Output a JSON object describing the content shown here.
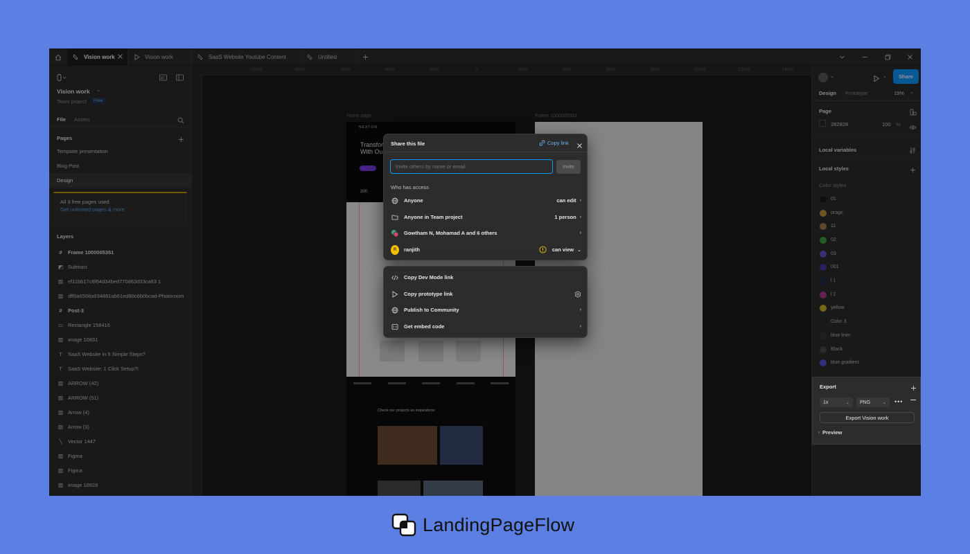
{
  "tabs": [
    {
      "label": "Vision work",
      "active": true,
      "icon": "figma-file-icon"
    },
    {
      "label": "Vision work",
      "active": false,
      "icon": "play-icon"
    },
    {
      "label": "SaaS Website Youtube Content",
      "active": false,
      "icon": "figma-file-icon"
    },
    {
      "label": "Untitled",
      "active": false,
      "icon": "figma-file-icon"
    }
  ],
  "left_panel": {
    "file_name": "Vision work",
    "team": "Team project",
    "plan_badge": "Free",
    "file_tab": "File",
    "assets_tab": "Assets",
    "pages_title": "Pages",
    "pages": [
      "Template presentation",
      "Blog Post",
      "Design"
    ],
    "notice": "All 3 free pages used.",
    "notice_link": "Get unlimited pages & more",
    "layers_title": "Layers",
    "layers": [
      {
        "name": "Frame 1000005351",
        "icon": "frame",
        "bold": true
      },
      {
        "name": "Subtract",
        "icon": "boolean",
        "bold": false
      },
      {
        "name": "ef11bb17c6f64d34bed770d83d33ca83 1",
        "icon": "image",
        "bold": false
      },
      {
        "name": "dff0a6558a934881ab61ed80c6b0bcad-Photoroom",
        "icon": "image",
        "bold": false
      },
      {
        "name": "Post-3",
        "icon": "frame",
        "bold": true
      },
      {
        "name": "Rectangle 158416",
        "icon": "rect",
        "bold": false
      },
      {
        "name": "image 10831",
        "icon": "image",
        "bold": false
      },
      {
        "name": "SaaS Website in 5 Simple Steps?",
        "icon": "text",
        "bold": false
      },
      {
        "name": "SaaS Website: 1 Click Setup?!",
        "icon": "text",
        "bold": false
      },
      {
        "name": "ARROW (42)",
        "icon": "image",
        "bold": false
      },
      {
        "name": "ARROW (51)",
        "icon": "image",
        "bold": false
      },
      {
        "name": "Arrow (4)",
        "icon": "image",
        "bold": false
      },
      {
        "name": "Arrow (3)",
        "icon": "image",
        "bold": false
      },
      {
        "name": "Vector 1447",
        "icon": "vector",
        "bold": false
      },
      {
        "name": "Figma",
        "icon": "image",
        "bold": false
      },
      {
        "name": "Figma",
        "icon": "image",
        "bold": false
      },
      {
        "name": "image 10828",
        "icon": "image",
        "bold": false
      }
    ]
  },
  "ruler_top": [
    "-10000",
    "-8000",
    "-6000",
    "-4000",
    "-2000",
    "0",
    "2000",
    "4000",
    "6000",
    "8000",
    "10000",
    "12000",
    "14000"
  ],
  "canvas": {
    "frame_label_1": "Home page",
    "frame_label_2": "Frame 1000005351",
    "mock_heading_1": "Transform",
    "mock_heading_2": "With Our",
    "mock_number": "200",
    "mock_section": "Check our projects as inspirations"
  },
  "right_panel": {
    "share_label": "Share",
    "design_tab": "Design",
    "prototype_tab": "Prototype",
    "zoom": "19%",
    "page_title": "Page",
    "page_color": "282828",
    "page_opacity": "100",
    "percent": "%",
    "local_variables": "Local variables",
    "local_styles": "Local styles",
    "color_styles_title": "Color styles",
    "color_styles": [
      {
        "name": "01",
        "color": "#1a1a1a"
      },
      {
        "name": "orage",
        "color": "#c8913a"
      },
      {
        "name": "11",
        "color": "#a67a4a"
      },
      {
        "name": "02",
        "color": "#3ea043"
      },
      {
        "name": "03",
        "color": "#6a4fd0"
      },
      {
        "name": "001",
        "color": "#4a3aa8"
      },
      {
        "name": "l 1",
        "color": "#1f2a44"
      },
      {
        "name": "l 2",
        "color": "#b03a8a"
      },
      {
        "name": "yellow",
        "color": "#c8b020"
      },
      {
        "name": "Color 3",
        "color": "#2a2a2a"
      },
      {
        "name": "blue liner",
        "color": "#3a3a3a"
      },
      {
        "name": "Black",
        "color": "#4a4a4a"
      },
      {
        "name": "blue gradient",
        "color": "#5b4fd8"
      }
    ],
    "export_title": "Export",
    "export_scale": "1x",
    "export_format": "PNG",
    "export_button": "Export Vision work",
    "preview": "Preview"
  },
  "share_dialog": {
    "title": "Share this file",
    "copy_link": "Copy link",
    "invite_placeholder": "Invite others by name or email",
    "invite_button": "Invite",
    "who_has_access": "Who has access",
    "access": [
      {
        "label": "Anyone",
        "permission": "can edit",
        "icon": "globe-icon"
      },
      {
        "label": "Anyone in Team project",
        "permission": "1 person",
        "icon": "folder-icon"
      },
      {
        "label": "Gowtham N, Mohamad A and 6 others",
        "permission": "",
        "icon": "avatars-icon"
      },
      {
        "label": "ranjith",
        "permission": "can view",
        "icon": "avatar-r",
        "avatar_letter": "R"
      }
    ]
  },
  "share_actions": [
    {
      "label": "Copy Dev Mode link",
      "icon": "code-icon"
    },
    {
      "label": "Copy prototype link",
      "icon": "play-icon"
    },
    {
      "label": "Publish to Community",
      "icon": "globe-icon"
    },
    {
      "label": "Get embed code",
      "icon": "embed-icon"
    }
  ],
  "brand": {
    "name": "LandingPageFlow"
  },
  "colors": {
    "background": "#5b7fe3",
    "accent": "#0d99ff",
    "app_bg": "#1e1e1e",
    "panel_bg": "#2c2c2c"
  }
}
